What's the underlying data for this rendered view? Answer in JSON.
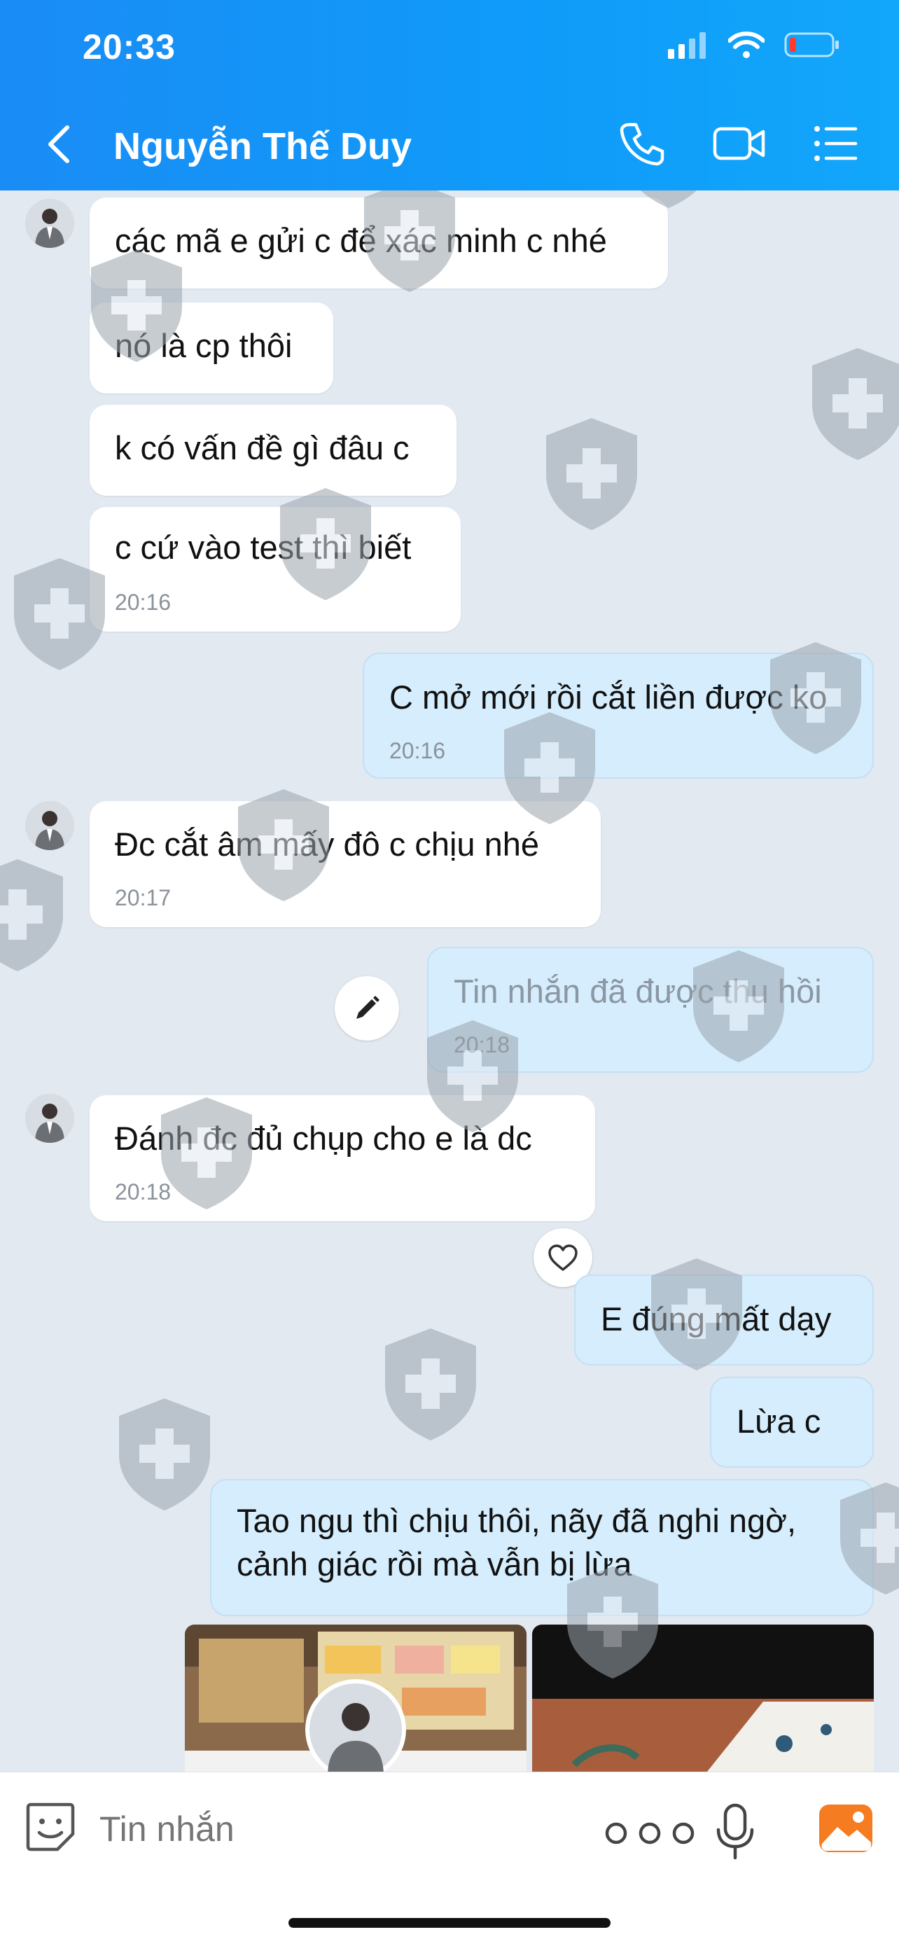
{
  "status_bar": {
    "time": "20:33"
  },
  "header": {
    "contact_name": "Nguyễn Thế Duy"
  },
  "messages": [
    {
      "text": "các mã e gửi c để xác minh c nhé"
    },
    {
      "text": "nó là cp thôi"
    },
    {
      "text": "k có vấn đề gì đâu c"
    },
    {
      "text": "c cứ vào test thì biết",
      "time": "20:16"
    },
    {
      "text": "C mở mới rồi cắt liền được ko",
      "time": "20:16"
    },
    {
      "text": "Đc cắt âm mấy đô c chịu nhé",
      "time": "20:17"
    },
    {
      "text": "Tin nhắn đã được thu hồi",
      "time": "20:18"
    },
    {
      "text": "Đánh đc đủ chụp cho e là dc",
      "time": "20:18"
    },
    {
      "text": "E đúng mất dạy"
    },
    {
      "text": "Lừa c"
    },
    {
      "line1": "Tao ngu thì chịu thôi, nãy đã nghi ngờ,",
      "line2": "cảnh giác rồi mà vẫn bị lừa"
    }
  ],
  "composer": {
    "placeholder": "Tin nhắn"
  },
  "colors": {
    "header": "#1a8cf5",
    "outgoing_bubble": "#d5edfc",
    "incoming_bubble": "#ffffff",
    "chat_bg": "#e2e9f1"
  },
  "icons": [
    "back-chevron-icon",
    "phone-icon",
    "video-camera-icon",
    "list-menu-icon",
    "signal-icon",
    "wifi-icon",
    "battery-icon",
    "sticker-icon",
    "more-icon",
    "microphone-icon",
    "image-icon",
    "edit-icon",
    "heart-icon"
  ]
}
